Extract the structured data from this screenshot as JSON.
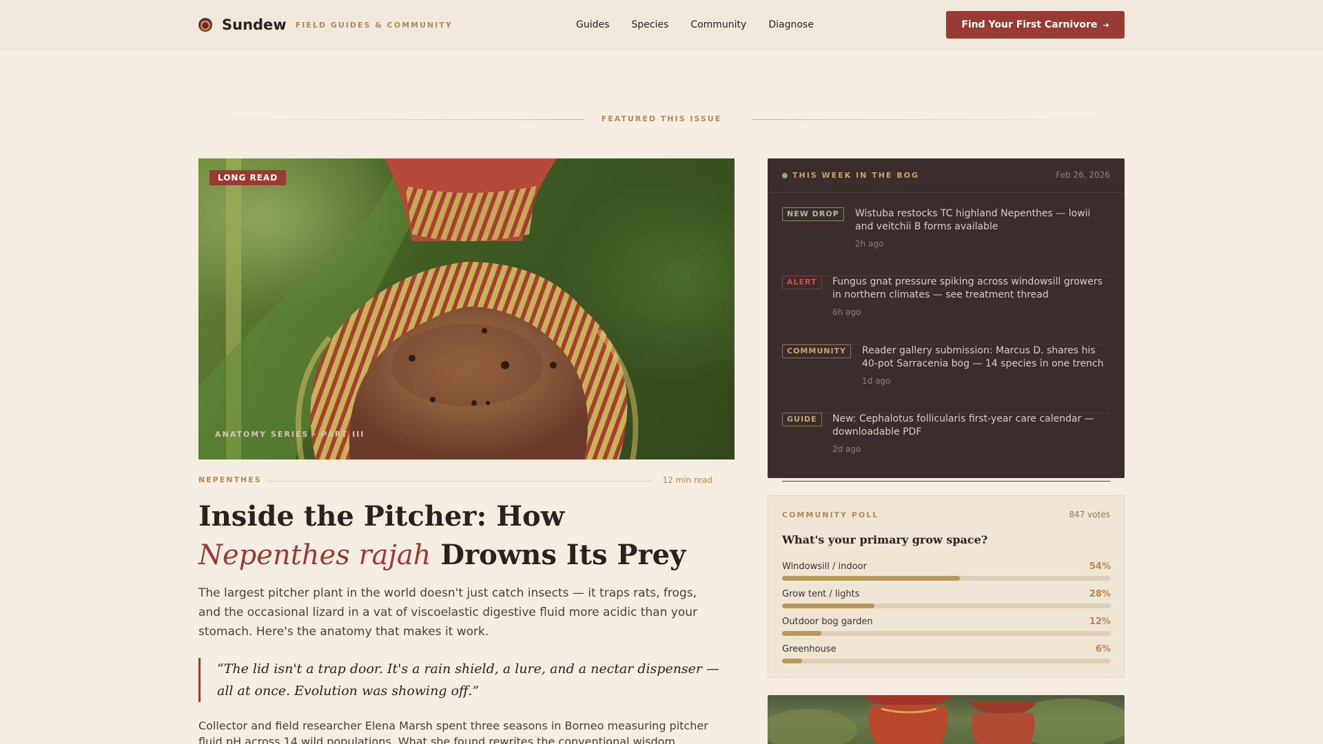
{
  "header": {
    "brand_name": "Sundew",
    "brand_tagline": "FIELD GUIDES & COMMUNITY",
    "nav": [
      "Guides",
      "Species",
      "Community",
      "Diagnose"
    ],
    "cta_label": "Find Your First Carnivore",
    "cta_arrow": "➔"
  },
  "featured_label": "FEATURED THIS ISSUE",
  "article": {
    "badge": "LONG READ",
    "image_caption": "ANATOMY SERIES · PART III",
    "category": "NEPENTHES",
    "read_time": "12 min read",
    "title_start": "Inside the Pitcher: How ",
    "title_italic": "Nepenthes rajah",
    "title_end": " Drowns Its Prey",
    "dek": "The largest pitcher plant in the world doesn't just catch insects — it traps rats, frogs, and the occasional lizard in a vat of viscoelastic digestive fluid more acidic than your stomach. Here's the anatomy that makes it work.",
    "quote": "“The lid isn't a trap door. It's a rain shield, a lure, and a nectar dispenser — all at once. Evolution was showing off.”",
    "body": "Collector and field researcher Elena Marsh spent three seasons in Borneo measuring pitcher fluid pH across 14 wild populations. What she found rewrites the conventional wisdom about highland"
  },
  "bog": {
    "title": "THIS WEEK IN THE BOG",
    "date": "Feb 26, 2026",
    "items": [
      {
        "tag": "NEW DROP",
        "text": "Wistuba restocks TC highland Nepenthes — lowii and veitchii B forms available",
        "ago": "2h ago"
      },
      {
        "tag": "ALERT",
        "text": "Fungus gnat pressure spiking across windowsill growers in northern climates — see treatment thread",
        "ago": "6h ago"
      },
      {
        "tag": "COMMUNITY",
        "text": "Reader gallery submission: Marcus D. shares his 40-pot Sarracenia bog — 14 species in one trench",
        "ago": "1d ago"
      },
      {
        "tag": "GUIDE",
        "text": "New: Cephalotus follicularis first-year care calendar — downloadable PDF",
        "ago": "2d ago"
      }
    ]
  },
  "poll": {
    "label": "COMMUNITY POLL",
    "votes": "847 votes",
    "question": "What's your primary grow space?",
    "options": [
      {
        "label": "Windowsill / indoor",
        "pct_text": "54%",
        "value": 0.54
      },
      {
        "label": "Grow tent / lights",
        "pct_text": "28%",
        "value": 0.28
      },
      {
        "label": "Outdoor bog garden",
        "pct_text": "12%",
        "value": 0.12
      },
      {
        "label": "Greenhouse",
        "pct_text": "6%",
        "value": 0.06
      }
    ]
  },
  "colors": {
    "accent": "#9a3a34",
    "gold": "#b48a52",
    "panel_dark": "#3a2d2c",
    "background": "#f5ede2"
  }
}
